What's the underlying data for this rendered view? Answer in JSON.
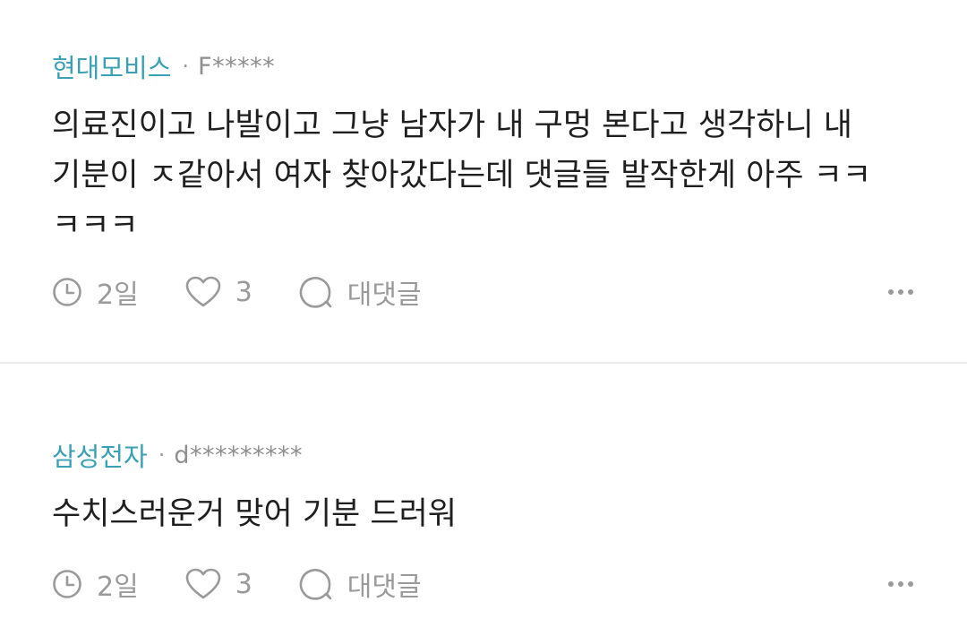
{
  "comments": [
    {
      "company": "현대모비스",
      "separator": "·",
      "author": "F*****",
      "text": "의료진이고 나발이고 그냥 남자가 내 구멍 본다고 생각하니 내\n기분이 ㅈ같아서 여자 찾아갔다는데 댓글들 발작한게 아주 ㅋㅋ\nㅋㅋㅋ",
      "time": "2일",
      "likes": "3",
      "reply_label": "대댓글"
    },
    {
      "company": "삼성전자",
      "separator": "·",
      "author": "d*********",
      "text": "수치스러운거 맞어 기분 드러워",
      "time": "2일",
      "likes": "3",
      "reply_label": "대댓글"
    }
  ],
  "icons": {
    "time": "clock-icon",
    "like": "heart-icon",
    "reply": "speech-bubble-icon",
    "more": "more-dots-icon"
  },
  "colors": {
    "company": "#3aa0b5",
    "meta": "#9a9a9a",
    "divider": "#ececec"
  }
}
